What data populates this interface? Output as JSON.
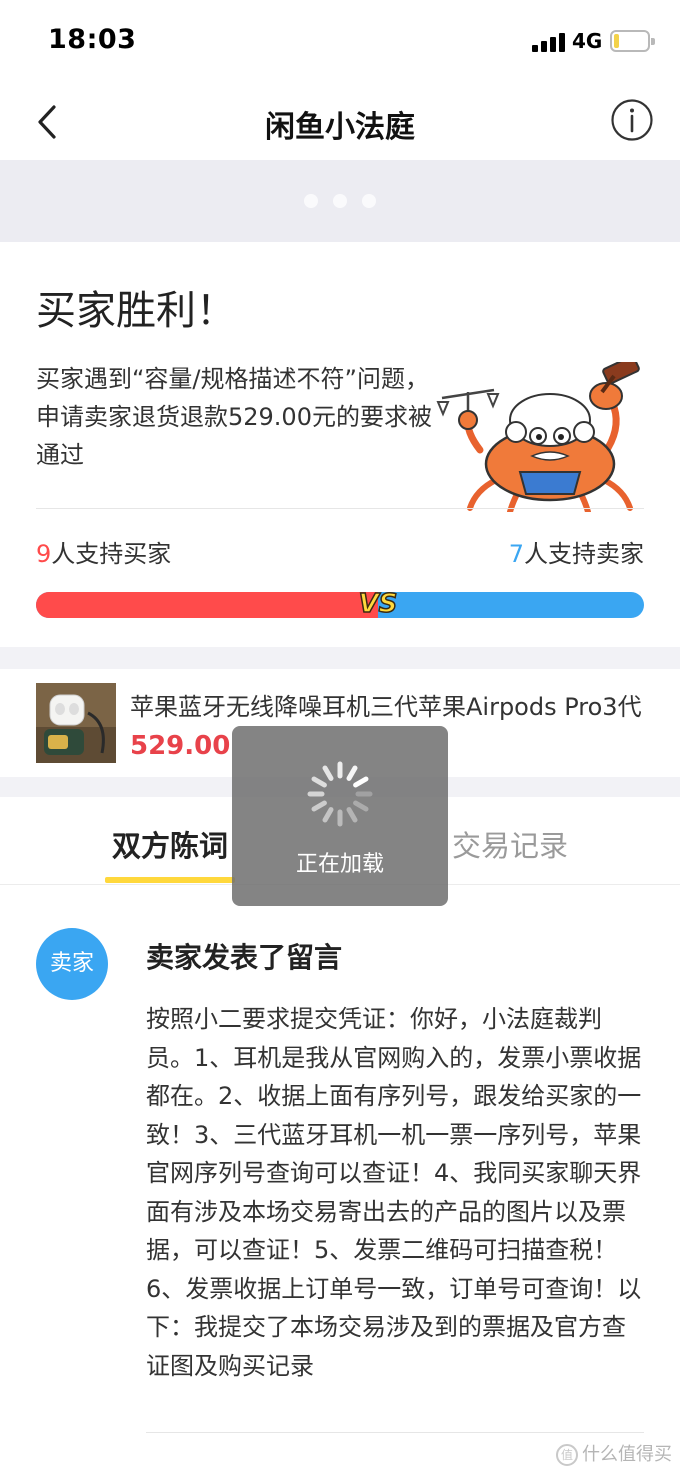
{
  "status_bar": {
    "time": "18:03",
    "network": "4G",
    "signal_bars": 4,
    "battery_level": 0.15
  },
  "nav": {
    "title": "闲鱼小法庭",
    "back_icon": "chevron-left-icon",
    "info_icon": "info-circle-icon"
  },
  "banner": {
    "page_dots": 3
  },
  "verdict": {
    "title": "买家胜利！",
    "description": "买家遇到“容量/规格描述不符”问题，申请卖家退货退款529.00元的要求被通过",
    "mascot": "crab-judge-illustration"
  },
  "vote": {
    "buyer_count": "9",
    "buyer_label": "人支持买家",
    "seller_count": "7",
    "seller_label": "人支持卖家",
    "buyer_share": 0.5625,
    "vs_label": "VS",
    "colors": {
      "buyer": "#ff4b4b",
      "seller": "#3aa6f2"
    }
  },
  "product": {
    "title": "苹果蓝牙无线降噪耳机三代苹果Airpods Pro3代",
    "price": "529.00",
    "thumbnail": "earphones-product-photo"
  },
  "tabs": [
    {
      "label": "双方陈词",
      "active": true
    },
    {
      "label": "交易记录",
      "active": false
    }
  ],
  "comment": {
    "avatar_label": "卖家",
    "title": "卖家发表了留言",
    "body": "按照小二要求提交凭证：你好，小法庭裁判员。1、耳机是我从官网购入的，发票小票收据都在。2、收据上面有序列号，跟发给买家的一致！3、三代蓝牙耳机一机一票一序列号，苹果官网序列号查询可以查证！4、我同买家聊天界面有涉及本场交易寄出去的产品的图片以及票据，可以查证！5、发票二维码可扫描查税！6、发票收据上订单号一致，订单号可查询！以下：我提交了本场交易涉及到的票据及官方查证图及购买记录"
  },
  "loading": {
    "text": "正在加载"
  },
  "watermark": {
    "text": "什么值得买"
  },
  "colors": {
    "accent_yellow": "#ffd83c",
    "price_red": "#e8424a",
    "avatar_blue": "#3aa6f2"
  }
}
